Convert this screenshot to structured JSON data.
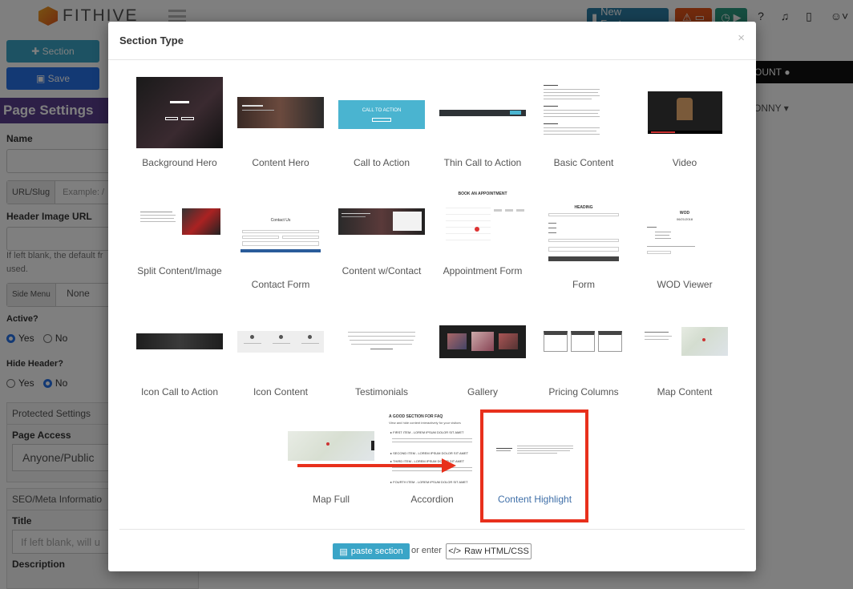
{
  "app": {
    "brand": "FITHIVE",
    "new_features_label": "New Features",
    "account_label": "OUNT",
    "user_label": "ONNY"
  },
  "sidebar": {
    "section_button": "Section",
    "save_button": "Save",
    "page_settings_title": "Page Settings",
    "name_label": "Name",
    "slug_prefix": "URL/Slug",
    "slug_placeholder": "Example: /",
    "header_image_label": "Header Image URL",
    "header_image_help": "If left blank, the default fr",
    "header_image_help2": "used.",
    "side_menu_prefix": "Side Menu",
    "side_menu_value": "None",
    "active_label": "Active?",
    "active_yes": "Yes",
    "active_no": "No",
    "hide_header_label": "Hide Header?",
    "hide_yes": "Yes",
    "hide_no": "No",
    "protected_settings": "Protected Settings",
    "page_access_label": "Page Access",
    "page_access_value": "Anyone/Public",
    "seo_label": "SEO/Meta Informatio",
    "title_label": "Title",
    "title_placeholder": "If left blank, will u",
    "description_label": "Description"
  },
  "modal": {
    "title": "Section Type",
    "close": "×",
    "tiles": [
      {
        "label": "Background Hero"
      },
      {
        "label": "Content Hero"
      },
      {
        "label": "Call to Action"
      },
      {
        "label": "Thin Call to Action"
      },
      {
        "label": "Basic Content"
      },
      {
        "label": "Video"
      },
      {
        "label": "Split Content/Image"
      },
      {
        "label": "Contact Form"
      },
      {
        "label": "Content w/Contact"
      },
      {
        "label": "Appointment Form"
      },
      {
        "label": "Form"
      },
      {
        "label": "WOD Viewer"
      },
      {
        "label": "Icon Call to Action"
      },
      {
        "label": "Icon Content"
      },
      {
        "label": "Testimonials"
      },
      {
        "label": "Gallery"
      },
      {
        "label": "Pricing Columns"
      },
      {
        "label": "Map Content"
      },
      {
        "label": "Map Full"
      },
      {
        "label": "Accordion"
      },
      {
        "label": "Content Highlight"
      }
    ],
    "paste_label": "paste section",
    "or_enter": "or enter",
    "raw_label": "Raw HTML/CSS",
    "thumb_text": {
      "cta": "CALL TO ACTION",
      "appointment": "BOOK AN APPOINTMENT",
      "form_heading": "HEADING",
      "wod": "WOD",
      "wod_date": "06/21/2018",
      "contact": "Contact Us",
      "accordion_title": "A GOOD SECTION FOR FAQ",
      "accordion_sub": "View and hide content interactively for your visitors",
      "accordion_items": [
        "FIRST ITEM - LOREM IPSUM DOLOR SIT AMET",
        "SECOND ITEM - LOREM IPSUM DOLOR SIT AMET",
        "THIRD ITEM - LOREM IPSUM DOLOR SIT AMET",
        "FOURTH ITEM - LOREM IPSUM DOLOR SIT AMET"
      ]
    }
  },
  "colors": {
    "highlight": "#e8301c",
    "modal_bg": "#ffffff",
    "teal": "#3aa5c7"
  }
}
